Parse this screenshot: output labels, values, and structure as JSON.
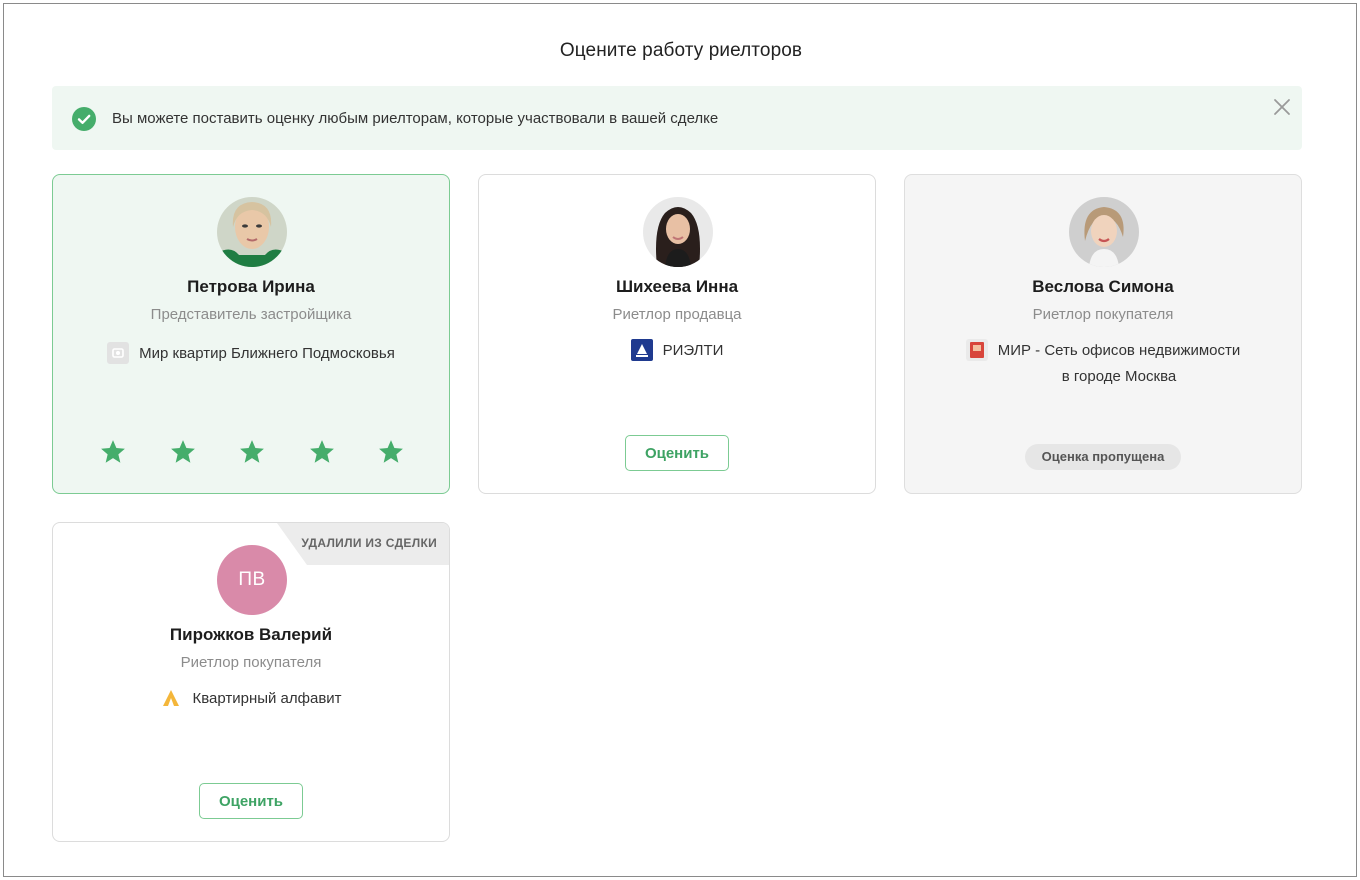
{
  "page": {
    "title": "Оцените работу риелторов"
  },
  "notice": {
    "text": "Вы можете поставить оценку любым риелторам, которые участвовали в вашей сделке",
    "icon": "check-circle-icon",
    "close_icon": "close-icon"
  },
  "cards": [
    {
      "name": "Петрова Ирина",
      "role": "Представитель застройщика",
      "company": "Мир квартир Ближнего Подмосковья",
      "state": "rated",
      "rating": 5,
      "rating_max": 5
    },
    {
      "name": "Шихеева Инна",
      "role": "Риетлор продавца",
      "company": "РИЭЛТИ",
      "state": "pending",
      "button_label": "Оценить"
    },
    {
      "name": "Веслова Симона",
      "role": "Риетлор покупателя",
      "company_line1": "МИР - Сеть офисов недвижимости",
      "company_line2": "в городе Москва",
      "state": "skipped",
      "badge": "Оценка пропущена"
    },
    {
      "initials": "ПВ",
      "name": "Пирожков Валерий",
      "role": "Риетлор покупателя",
      "company": "Квартирный алфавит",
      "state": "removed",
      "tag": "УДАЛИЛИ ИЗ СДЕЛКИ",
      "button_label": "Оценить"
    }
  ],
  "colors": {
    "accent": "#45ad6b",
    "notice_bg": "#eff7f2",
    "initials_avatar": "#d98aa9"
  }
}
